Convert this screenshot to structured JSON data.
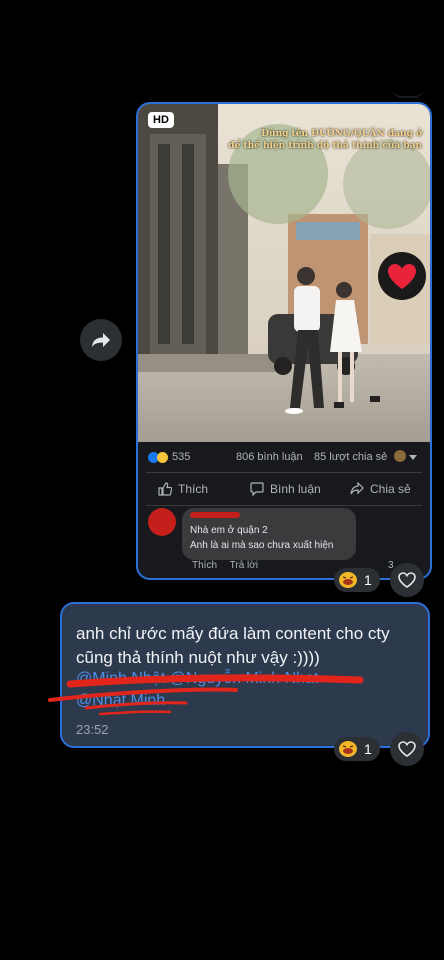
{
  "shared_post": {
    "hd_label": "HD",
    "caption_line1": "Dùng tên ĐƯỜNG/QUẬN đang ở",
    "caption_line2": "để thể hiện trình độ thả thính của bạn",
    "reaction_count": "535",
    "comments_count": "806 bình luận",
    "shares_count": "85 lượt chia sẻ",
    "actions": {
      "like": "Thích",
      "comment": "Bình luận",
      "share": "Chia sẻ"
    },
    "top_comment": {
      "line1": "Nhà em ở quận 2",
      "line2": "Anh là ai mà sao chưa xuất hiện",
      "like": "Thích",
      "reply": "Trả lời",
      "count_fragment": "3"
    }
  },
  "post_reaction": {
    "count": "1"
  },
  "message": {
    "text": "anh chỉ ước mấy đứa làm content cho cty cũng thả thính nuột như vậy :))))",
    "mention_line1": "@Minh Nhật @Nguyễn Minh Nhat",
    "mention_line2": "@Nhật Minh",
    "time": "23:52"
  },
  "message_reaction": {
    "count": "1"
  },
  "colors": {
    "bubble_border": "#2c6fd6",
    "message_bg": "#2d3a4d",
    "link": "#4e8fe6",
    "scribble": "#e2251b"
  },
  "icons": [
    "forward-icon",
    "heart-icon",
    "like-icon",
    "comment-icon",
    "share-icon",
    "haha-emoji-icon"
  ]
}
